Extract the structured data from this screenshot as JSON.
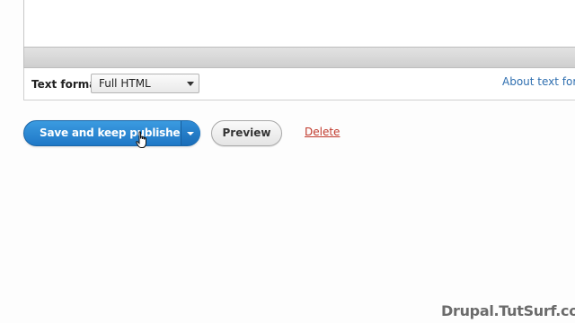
{
  "text_format": {
    "label": "Text format",
    "selected": "Full HTML",
    "about_link": "About text form"
  },
  "actions": {
    "save_label": "Save and keep published",
    "preview_label": "Preview",
    "delete_label": "Delete"
  },
  "watermark": "Drupal.TutSurf.com",
  "colors": {
    "primary_button": "#2a87d3",
    "link": "#2f6fb0",
    "delete_link": "#c0392b"
  },
  "icons": {
    "dropdown_arrow": "chevron-down-icon",
    "cursor": "hand-pointer-icon"
  }
}
